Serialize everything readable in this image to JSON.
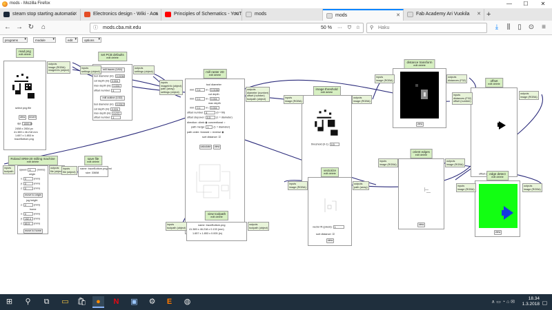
{
  "window": {
    "title": "mods - Mozilla Firefox",
    "minimize": "—",
    "maximize": "☐",
    "close": "✕"
  },
  "tabs": [
    {
      "label": "steam stop starting automatic",
      "color": "#1b2838"
    },
    {
      "label": "Electronics design - Wiki - Aca",
      "color": "#e44d26"
    },
    {
      "label": "Principles of Schematics - YouT",
      "color": "#ff0000"
    },
    {
      "label": "mods",
      "color": "#cccccc"
    },
    {
      "label": "mods",
      "color": "#cccccc"
    },
    {
      "label": "Fab Academy Ari Vuokila",
      "color": "#cccccc"
    }
  ],
  "nav": {
    "url": "mods.cba.mit.edu",
    "zoom": "50 %",
    "search_placeholder": "Haku"
  },
  "menus": [
    "programs",
    "module",
    "edit",
    "options"
  ],
  "modules": {
    "read_png": {
      "title": "read png",
      "edit": "edit delete",
      "outputs": "outputs\nimage (RGBA)\nimageInfo (object)",
      "file": "select png file",
      "view": "view",
      "invert": "invert",
      "dpi_label": "dpi:",
      "dpi": "1000.00",
      "px": "2458 x 2834 px",
      "mm": "41.389 x 46.218 mm",
      "in": "1.657 x 1.853 in",
      "name": "traceBottom.png"
    },
    "set_pcb": {
      "title": "set PCB defaults",
      "edit": "edit delete",
      "inputs": "inputs\nsettings (object)",
      "outputs": "outputs\nsettings (object)",
      "mill_traces": "mill traces (1/64)",
      "rows": [
        {
          "label": "tool diameter (in):",
          "value": "0.0156"
        },
        {
          "label": "cut depth (in):",
          "value": "0.004"
        },
        {
          "label": "max depth (in):",
          "value": "0.004"
        },
        {
          "label": "offset number:",
          "value": "4"
        }
      ],
      "mill_outline": "mill outline (1/32)",
      "rows2": [
        {
          "label": "tool diameter (in):",
          "value": "0.0312"
        },
        {
          "label": "cut depth (in):",
          "value": "0.024"
        },
        {
          "label": "max depth (in):",
          "value": "0.072"
        },
        {
          "label": "offset number:",
          "value": "1"
        }
      ]
    },
    "mill_raster": {
      "title": "mill raster 2D",
      "edit": "edit delete",
      "inputs": "inputs\nimageInfo (object)\npath (array)\nsettings (object)",
      "outputs": "outputs\ndiameter (number)\noffset (number)\ntoolpath (object)",
      "tool_diameter": "tool diameter",
      "mm": "mm:",
      "in": "in:",
      "d_mm": "0.4",
      "d_in": "0.0156",
      "cut_depth": "cut depth",
      "c_mm": "0.1",
      "c_in": "0.004",
      "max_depth": "max depth",
      "m_mm": "0.1",
      "m_in": "0.004",
      "offset_number": "offset number:",
      "offset_val": "4",
      "offset_note": "(0 = fill)",
      "offset_stepover": "offset stepover:",
      "stepover_val": "0.5",
      "stepover_note": "(1 = diameter)",
      "direction": "direction:",
      "climb": "climb",
      "conventional": "conventional",
      "path_merge": "path merge:",
      "merge_val": "1",
      "merge_note": "(1 = diameter)",
      "path_order": "path order:",
      "forward": "forward",
      "reverse": "reverse",
      "sort": "sort distance:",
      "calculate": "calculate",
      "view": "view"
    },
    "image_threshold": {
      "title": "image threshold",
      "edit": "edit delete",
      "inputs": "inputs\nimage (RGBA)",
      "outputs": "outputs\nimage (RGBA)",
      "threshold_label": "threshold (0-1):",
      "threshold": "0.5"
    },
    "distance_transform": {
      "title": "distance transform",
      "edit": "edit delete",
      "inputs": "inputs\nimage (RGBA)",
      "outputs": "outputs\ndistances (F32)",
      "view": "view"
    },
    "offset": {
      "title": "offset",
      "edit": "edit delete",
      "inputs": "inputs\ndistances (F32)\noffset (number)",
      "outputs": "outputs\nimage (RGBA)",
      "offset_label": "offset (pixels):",
      "offset_val": "98.430"
    },
    "edge_detect": {
      "title": "edge detect",
      "edit": "edit delete",
      "inputs": "inputs\nimage (RGBA)",
      "outputs": "outputs\nimage (RGBA)",
      "view": "view"
    },
    "orient_edges": {
      "title": "orient edges",
      "edit": "edit delete",
      "inputs": "inputs\nimage (RGBA)",
      "outputs": "outputs\nimage (RGBA)",
      "view": "view"
    },
    "vectorize": {
      "title": "vectorize",
      "edit": "edit delete",
      "inputs": "inputs\nimage (RGBA)",
      "outputs": "outputs\npath (array)",
      "error_label": "vector fit (pixels):",
      "error_val": "1",
      "sort_label": "sort distance:",
      "view": "view"
    },
    "roland": {
      "title": "Roland SRM-20 milling machine",
      "edit": "edit delete",
      "inputs": "inputs\ntoolpath",
      "outputs": "outputs\nfile (object)",
      "speed_label": "speed:",
      "speed": "4",
      "speed_unit": "(mm/s)",
      "origin": "origin",
      "x": "x:",
      "y": "y:",
      "z": "z:",
      "ox": "0",
      "oy": "0",
      "oz": "0",
      "unit": "(mm)",
      "move_origin": "move to origin",
      "jog_height": "jog height",
      "jog_z": "z:",
      "jog_val": "2",
      "home": "home",
      "hx": "0",
      "hy": "152.4",
      "hz": "60.5",
      "move_home": "move to home"
    },
    "save_file": {
      "title": "save file",
      "edit": "edit delete",
      "inputs": "inputs\nfile (object)",
      "name": "name: traceBottom.png.rml",
      "size": "size: 33658"
    },
    "view_toolpath": {
      "title": "view toolpath",
      "edit": "edit delete",
      "inputs": "inputs\ntoolpath (object)",
      "outputs": "outputs\ntoolpath (object)",
      "name": "name: traceBottom.png",
      "mm": "41.389 x 46.218 x 0.133 (mm)",
      "in": "1.657 x 1.853 x 0.005 (in)"
    }
  },
  "taskbar": {
    "time": "18.34",
    "date": "1.3.2018"
  }
}
